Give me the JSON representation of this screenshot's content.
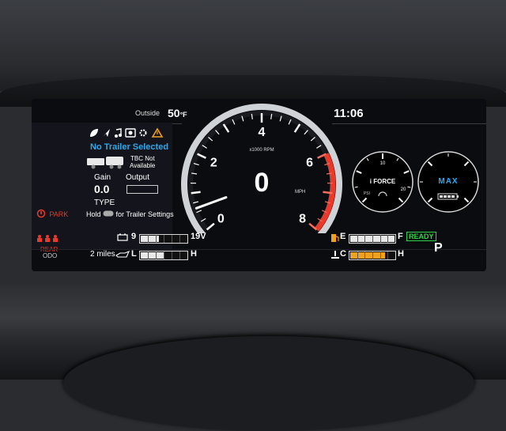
{
  "cluster": {
    "outside_label": "Outside",
    "outside_temp": "50",
    "outside_unit": "°F",
    "clock": "11:06"
  },
  "trailer": {
    "status": "No Trailer Selected",
    "tbc_line1": "TBC Not",
    "tbc_line2": "Available",
    "gain_label": "Gain",
    "gain_value": "0.0",
    "output_label": "Output",
    "type_label": "TYPE",
    "hold_label": "Hold",
    "hold_suffix": "for Trailer Settings"
  },
  "indicators": {
    "park_label": "PARK",
    "rear_label": "REAR",
    "odo_label": "ODO",
    "ready_label": "READY",
    "gear": "P"
  },
  "speedometer": {
    "speed": "0",
    "speed_unit": "MPH",
    "rpm_label": "x1000 RPM",
    "ticks": [
      "0",
      "2",
      "4",
      "6",
      "8"
    ],
    "rpm": 0.6,
    "rpm_max": 8,
    "redline_start": 6
  },
  "gauges": {
    "battery_min": "9",
    "battery_max": "19V",
    "battery_level": 0.4,
    "trip_distance": "2 miles",
    "oil_low": "L",
    "oil_high": "H",
    "oil_level": 0.5,
    "fuel_empty": "E",
    "fuel_full": "F",
    "fuel_level": 1.0,
    "temp_cold": "C",
    "temp_hot": "H",
    "temp_level": 0.78
  },
  "boost": {
    "brand": "i FORCE",
    "unit": "PSI",
    "tick_10": "10",
    "tick_20": "20"
  },
  "power": {
    "mode_label": "MAX"
  },
  "colors": {
    "accent_blue": "#2aa8f0",
    "warning_red": "#e8392a",
    "ready_green": "#33d14a",
    "amber": "#f0a020"
  }
}
